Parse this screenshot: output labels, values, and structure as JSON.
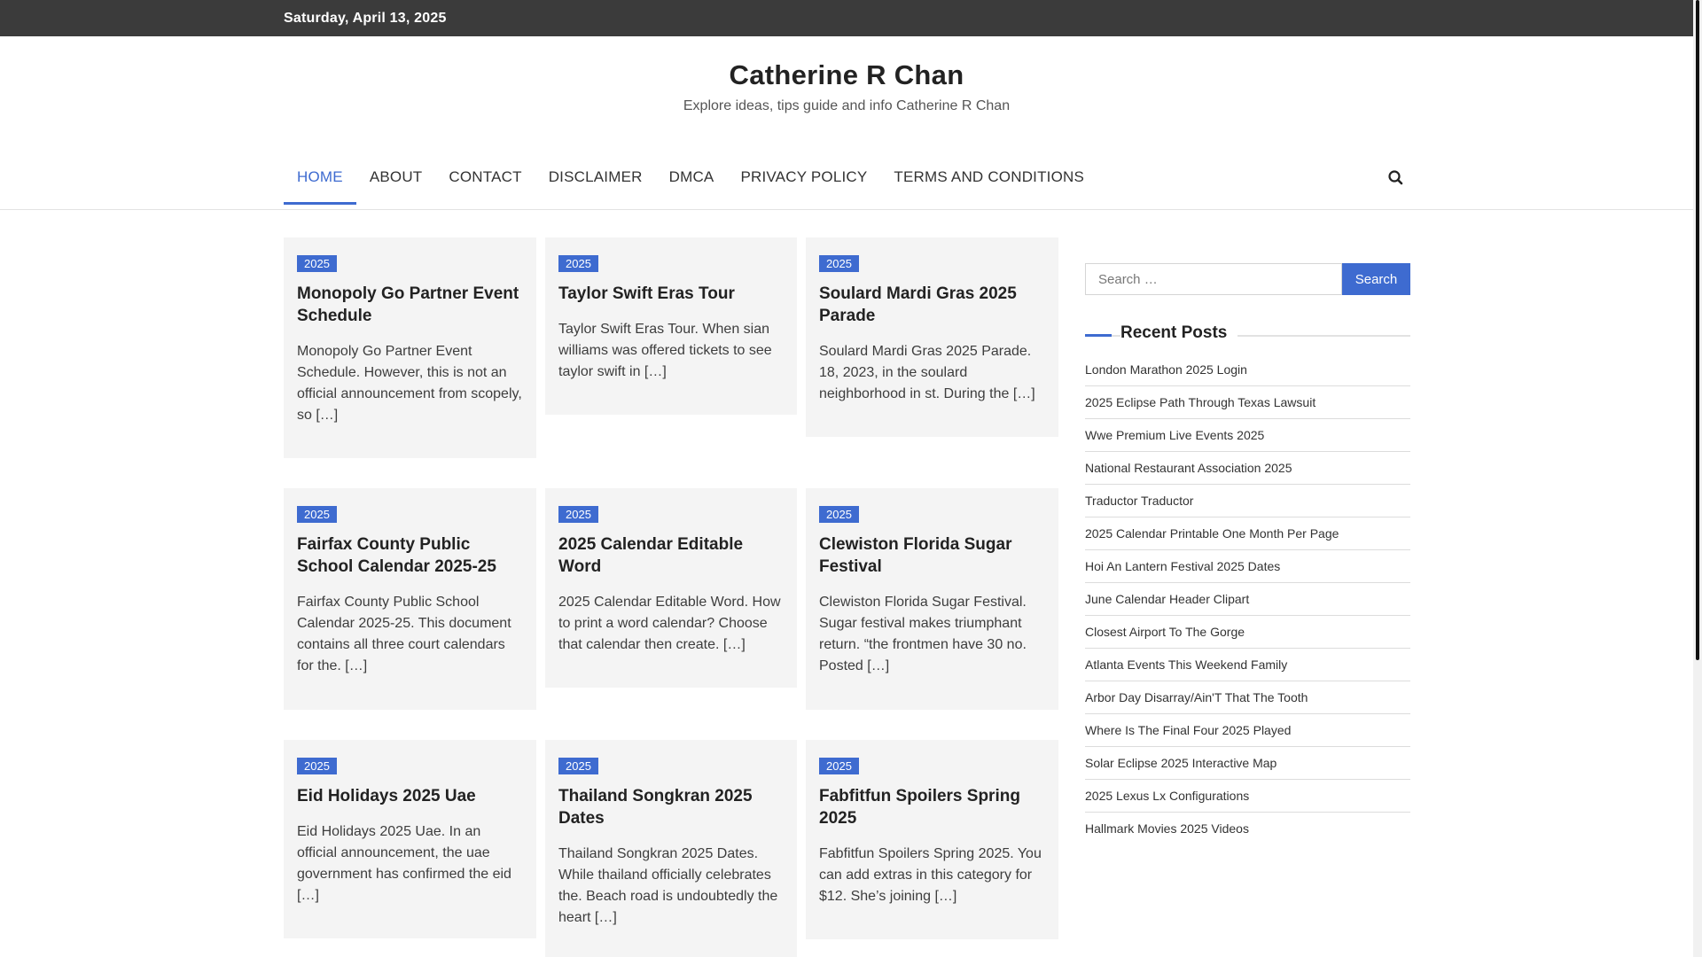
{
  "topbar": {
    "date": "Saturday, April 13, 2025"
  },
  "site": {
    "title": "Catherine R Chan",
    "description": "Explore ideas, tips guide and info Catherine R Chan"
  },
  "nav": {
    "items": [
      "HOME",
      "ABOUT",
      "CONTACT",
      "DISCLAIMER",
      "DMCA",
      "PRIVACY POLICY",
      "TERMS AND CONDITIONS"
    ],
    "active": "HOME",
    "search_icon": "search-icon"
  },
  "posts": [
    {
      "badge": "2025",
      "title": "Monopoly Go Partner Event Schedule",
      "excerpt": "Monopoly Go Partner Event Schedule. However, this is not an official announcement from scopely, so […]"
    },
    {
      "badge": "2025",
      "title": "Taylor Swift Eras Tour",
      "excerpt": "Taylor Swift Eras Tour. When sian williams was offered tickets to see taylor swift in […]"
    },
    {
      "badge": "2025",
      "title": "Soulard Mardi Gras 2025 Parade",
      "excerpt": "Soulard Mardi Gras 2025 Parade. 18, 2023, in the soulard neighborhood in st. During the […]"
    },
    {
      "badge": "2025",
      "title": "Fairfax County Public School Calendar 2025-25",
      "excerpt": "Fairfax County Public School Calendar 2025-25. This document contains all three court calendars for the. […]"
    },
    {
      "badge": "2025",
      "title": "2025 Calendar Editable Word",
      "excerpt": "2025 Calendar Editable Word. How to print a word calendar? Choose that calendar then create. […]"
    },
    {
      "badge": "2025",
      "title": "Clewiston Florida Sugar Festival",
      "excerpt": "Clewiston Florida Sugar Festival. Sugar festival makes triumphant return. “the frontmen have 30 no. Posted […]"
    },
    {
      "badge": "2025",
      "title": "Eid Holidays 2025 Uae",
      "excerpt": "Eid Holidays 2025 Uae. In an official announcement, the uae government has confirmed the eid […]"
    },
    {
      "badge": "2025",
      "title": "Thailand Songkran 2025 Dates",
      "excerpt": "Thailand Songkran 2025 Dates. While thailand officially celebrates the. Beach road is undoubtedly the heart […]"
    },
    {
      "badge": "2025",
      "title": "Fabfitfun Spoilers Spring 2025",
      "excerpt": "Fabfitfun Spoilers Spring 2025. You can add extras in this category for $12. She’s joining […]"
    }
  ],
  "sidebar": {
    "search_placeholder": "Search …",
    "search_button": "Search",
    "recent_title": "Recent Posts",
    "recent_posts": [
      "London Marathon 2025 Login",
      "2025 Eclipse Path Through Texas Lawsuit",
      "Wwe Premium Live Events 2025",
      "National Restaurant Association 2025",
      "Traductor Traductor",
      "2025 Calendar Printable One Month Per Page",
      "Hoi An Lantern Festival 2025 Dates",
      "June Calendar Header Clipart",
      "Closest Airport To The Gorge",
      "Atlanta Events This Weekend Family",
      "Arbor Day Disarray/Ain'T That The Tooth",
      "Where Is The Final Four 2025 Played",
      "Solar Eclipse 2025 Interactive Map",
      "2025 Lexus Lx Configurations",
      "Hallmark Movies 2025 Videos"
    ]
  },
  "colors": {
    "accent": "#3e6bd0",
    "topbar": "#3b3b3b",
    "card": "#f4f4f4"
  }
}
